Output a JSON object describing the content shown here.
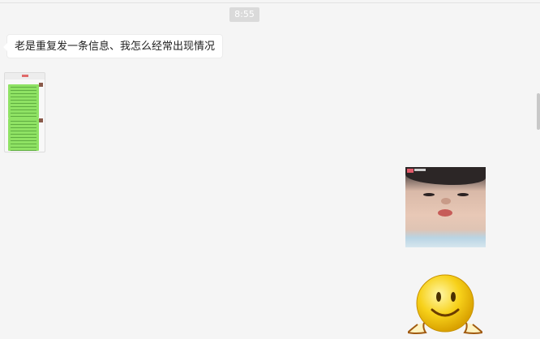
{
  "chat": {
    "timestamp": "8:55",
    "messages": [
      {
        "type": "text",
        "text": "老是重复发一条信息、我怎么经常出现情况"
      },
      {
        "type": "image",
        "icon": "chat-screenshot-thumbnail"
      },
      {
        "type": "image",
        "icon": "child-photo"
      },
      {
        "type": "sticker",
        "icon": "smiley-sticker"
      }
    ]
  },
  "colors": {
    "background": "#f5f5f5",
    "bubble": "#ffffff",
    "timestamp_bg": "#dadada",
    "sticker_yellow": "#f7d11a"
  }
}
